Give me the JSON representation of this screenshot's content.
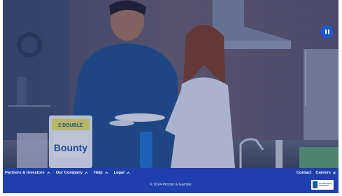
{
  "hero": {
    "pause_button_label": "Pause background video",
    "product_package": {
      "brand": "Bounty",
      "badge": "2 DOUBLE"
    }
  },
  "footer": {
    "nav": [
      {
        "label": "Partners & Investors"
      },
      {
        "label": "Our Company"
      },
      {
        "label": "Help"
      },
      {
        "label": "Legal"
      }
    ],
    "right_links": [
      {
        "label": "Contact"
      },
      {
        "label": "Careers"
      }
    ],
    "copyright": "© 2024 Procter & Gamble",
    "badge_text": [
      "ACCREDITED",
      "BUSINESS"
    ]
  },
  "colors": {
    "footer_bg": "#1f3fae",
    "accent": "#1f56c8"
  },
  "icons": {
    "nav_caret": "chevron-up-icon",
    "external": "external-link-icon",
    "pause": "pause-icon"
  }
}
